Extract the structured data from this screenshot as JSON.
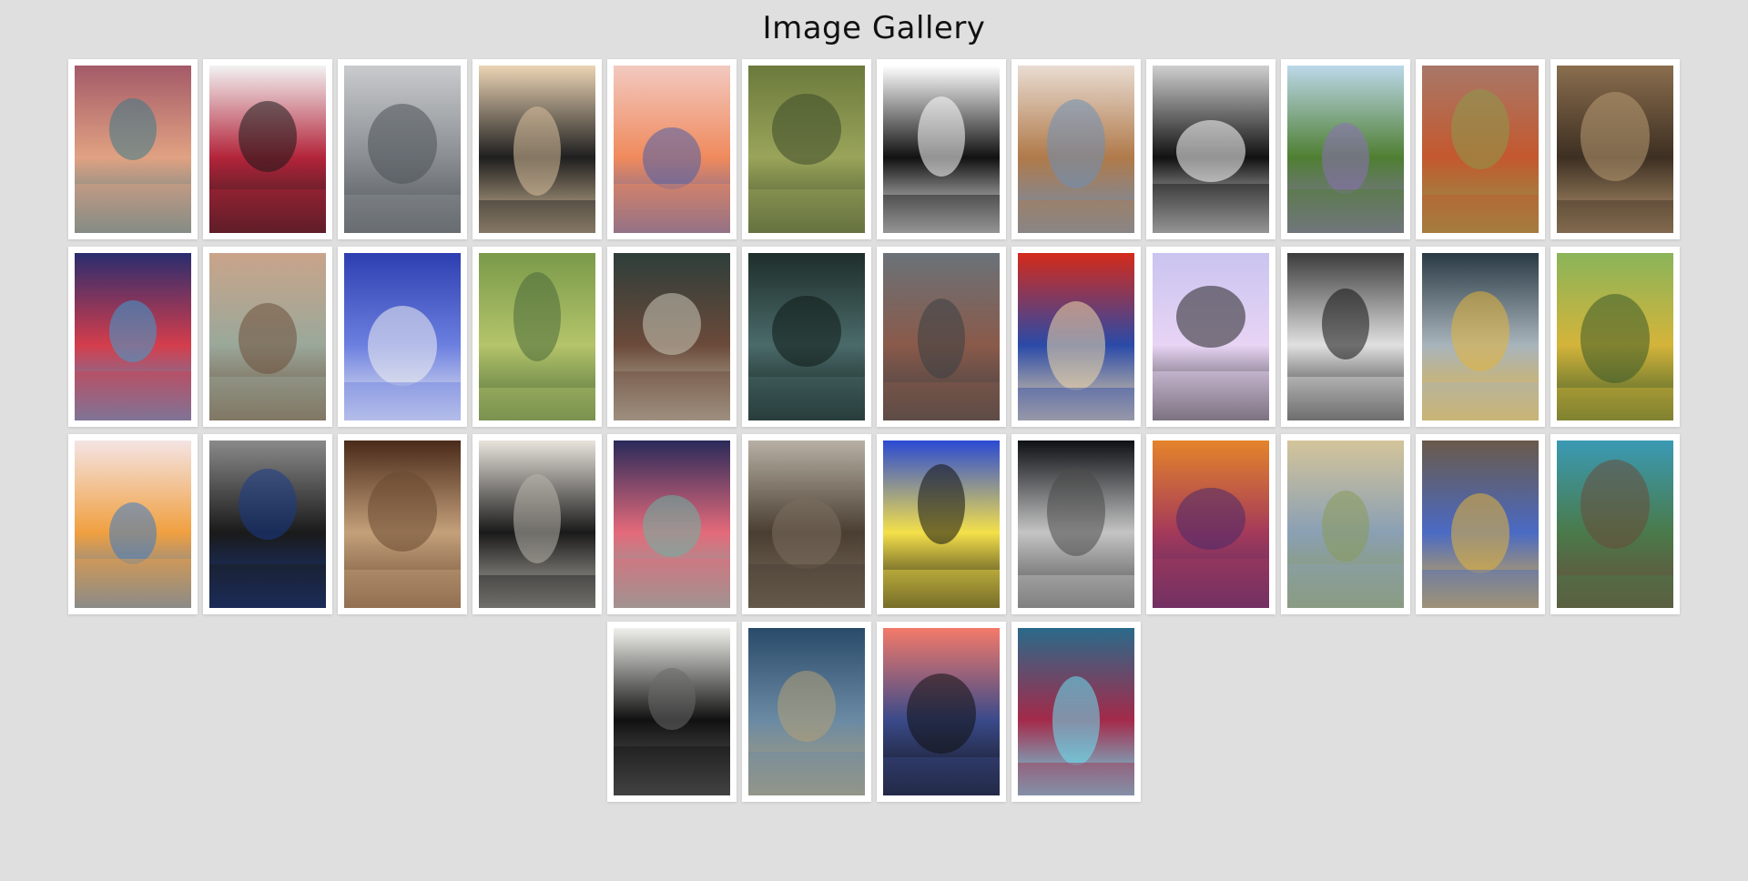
{
  "page": {
    "title": "Image Gallery"
  },
  "gallery": {
    "items": [
      {
        "icon": "face-distortion-painting",
        "colors": [
          "#a45a68",
          "#e0a282",
          "#3a7a88"
        ]
      },
      {
        "icon": "floral-face-portrait",
        "colors": [
          "#f2f2f2",
          "#b3243a",
          "#1a1a1a"
        ]
      },
      {
        "icon": "misty-city-skyline",
        "colors": [
          "#c9cbcd",
          "#8a8e93",
          "#4d5257"
        ]
      },
      {
        "icon": "puzzle-silhouette",
        "colors": [
          "#ebd4b4",
          "#1f1f1f",
          "#d8c09c"
        ]
      },
      {
        "icon": "lake-sunset",
        "colors": [
          "#f2c9c0",
          "#f08a5d",
          "#4a5fa8"
        ]
      },
      {
        "icon": "bridge-water-lilies",
        "colors": [
          "#6b7a3c",
          "#9aa45a",
          "#3c4a2a"
        ]
      },
      {
        "icon": "line-art-faces",
        "colors": [
          "#ffffff",
          "#111111",
          "#ffffff"
        ]
      },
      {
        "icon": "girl-and-dog",
        "colors": [
          "#e9dcd2",
          "#b07a4a",
          "#6b8fb8"
        ]
      },
      {
        "icon": "ink-creature-sketch",
        "colors": [
          "#cfcfcf",
          "#111111",
          "#ffffff"
        ]
      },
      {
        "icon": "cottage-meadow",
        "colors": [
          "#bcd8ea",
          "#4f7f32",
          "#8c6fb8"
        ]
      },
      {
        "icon": "hands-rubiks-cube",
        "colors": [
          "#a87868",
          "#c4582e",
          "#8a9a4a"
        ]
      },
      {
        "icon": "figure-with-shadow",
        "colors": [
          "#8a6e4e",
          "#3d2f22",
          "#b89a72"
        ]
      },
      {
        "icon": "cluttered-neon-room",
        "colors": [
          "#2a2d6e",
          "#d43d4c",
          "#3aa0d4"
        ]
      },
      {
        "icon": "woman-with-leaf",
        "colors": [
          "#c9a48a",
          "#9aa89a",
          "#6e4e3a"
        ]
      },
      {
        "icon": "blue-laundromat",
        "colors": [
          "#2d3fb0",
          "#6b7fe0",
          "#f0f0f0"
        ]
      },
      {
        "icon": "forest-path-anime",
        "colors": [
          "#7a9a4a",
          "#b4c46a",
          "#4a6a3a"
        ]
      },
      {
        "icon": "woman-in-water",
        "colors": [
          "#2e3e3a",
          "#6b4a3a",
          "#c9c9b8"
        ]
      },
      {
        "icon": "dark-forest-stream",
        "colors": [
          "#1e2e2a",
          "#4a6a6a",
          "#0e1a16"
        ]
      },
      {
        "icon": "lighthouse-ruin",
        "colors": [
          "#6a7278",
          "#8a5a4a",
          "#3a4044"
        ]
      },
      {
        "icon": "flamenco-dancer",
        "colors": [
          "#d42a1a",
          "#2a4aa8",
          "#f0d8a8"
        ]
      },
      {
        "icon": "power-lines-sky",
        "colors": [
          "#c9c4f0",
          "#e8d4f4",
          "#222222"
        ]
      },
      {
        "icon": "dark-fluffy-creature",
        "colors": [
          "#3c3c3c",
          "#e0e0e0",
          "#111111"
        ]
      },
      {
        "icon": "man-with-masks",
        "colors": [
          "#2a3a44",
          "#a8b4bc",
          "#e4b43a"
        ]
      },
      {
        "icon": "sunflower-head-man",
        "colors": [
          "#8ab45a",
          "#d4b43a",
          "#3a5a2a"
        ]
      },
      {
        "icon": "watercolor-sunset-waves",
        "colors": [
          "#f4e4e4",
          "#f0a040",
          "#3a7ac4"
        ]
      },
      {
        "icon": "ink-head-splash",
        "colors": [
          "#8a8a8a",
          "#1a1a1a",
          "#1a3a8a"
        ]
      },
      {
        "icon": "sleeping-figure",
        "colors": [
          "#4a2a1a",
          "#c4a07a",
          "#6a4a32"
        ]
      },
      {
        "icon": "the-scream-woodcut",
        "colors": [
          "#e8e4dc",
          "#1a1a1a",
          "#b8b4ac"
        ]
      },
      {
        "icon": "floating-island-whale",
        "colors": [
          "#2a2a5a",
          "#e46a7a",
          "#6ab4a4"
        ]
      },
      {
        "icon": "embracing-couple",
        "colors": [
          "#b8b0a4",
          "#4a3e32",
          "#7a6e5e"
        ]
      },
      {
        "icon": "streetlamp-figure",
        "colors": [
          "#2a4ad4",
          "#f4e04a",
          "#111111"
        ]
      },
      {
        "icon": "lightbulb-woman-dark",
        "colors": [
          "#0e1014",
          "#c4c4c4",
          "#4a4a4a"
        ]
      },
      {
        "icon": "autumn-forest",
        "colors": [
          "#e4842a",
          "#a43a5a",
          "#4a2a6a"
        ]
      },
      {
        "icon": "beach-dunes-path",
        "colors": [
          "#d4c49a",
          "#8aa0b4",
          "#8a9a5a"
        ]
      },
      {
        "icon": "glitch-girl-portrait",
        "colors": [
          "#6a5a4a",
          "#4a6ac4",
          "#e4b43a"
        ]
      },
      {
        "icon": "coastal-village",
        "colors": [
          "#3a9ab4",
          "#4a7a4a",
          "#6a4a3a"
        ]
      },
      {
        "icon": "scribble-silhouette-poster",
        "colors": [
          "#f0f0ec",
          "#111111",
          "#6a6a6a"
        ]
      },
      {
        "icon": "old-guitarist",
        "colors": [
          "#2a4a6a",
          "#6a8aa4",
          "#b4a074"
        ]
      },
      {
        "icon": "lighthouse-sunset-shore",
        "colors": [
          "#f47a6a",
          "#3a4a8a",
          "#111111"
        ]
      },
      {
        "icon": "demon-goat-portrait",
        "colors": [
          "#2a6a8a",
          "#a42a4a",
          "#6ae4f4"
        ]
      }
    ]
  }
}
